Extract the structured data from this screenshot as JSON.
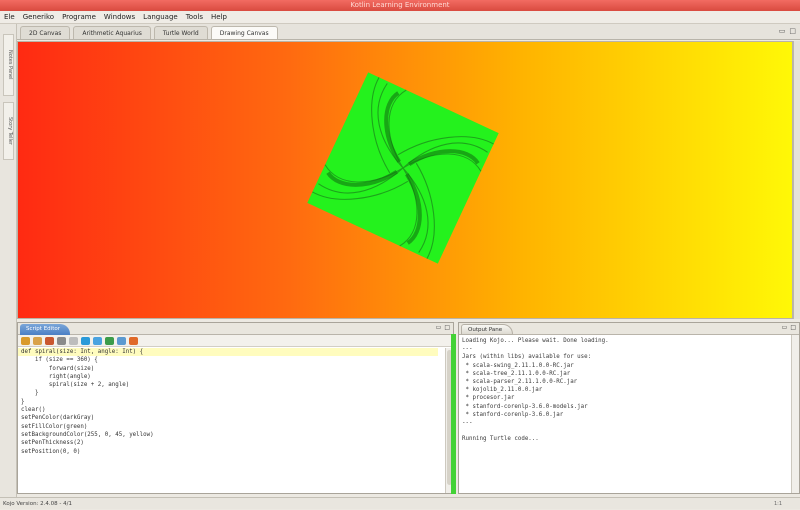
{
  "window": {
    "title": "Kotlin Learning Environment"
  },
  "menu": [
    "Ele",
    "Generiko",
    "Programe",
    "Windows",
    "Language",
    "Tools",
    "Help"
  ],
  "tabs": [
    {
      "label": "2D Canvas",
      "active": false
    },
    {
      "label": "Arithmetic Aquarius",
      "active": false
    },
    {
      "label": "Turtle World",
      "active": false
    },
    {
      "label": "Drawing Canvas",
      "active": true
    }
  ],
  "left_panels": [
    "Notes Panel",
    "Story Teller"
  ],
  "canvas": {
    "gradient": [
      "#ff2a12",
      "#ffb300",
      "#fff806"
    ],
    "shape_fill": "#24f21d",
    "shape_stroke": "#1a8a1a"
  },
  "script_editor": {
    "title": "Script Editor",
    "lines": [
      {
        "text": "def spiral(size: Int, angle: Int) {",
        "highlight": true
      },
      {
        "text": "    if (size == 360) {",
        "highlight": false
      },
      {
        "text": "        forward(size)",
        "highlight": false
      },
      {
        "text": "        right(angle)",
        "highlight": false
      },
      {
        "text": "        spiral(size + 2, angle)",
        "highlight": false
      },
      {
        "text": "    }",
        "highlight": false
      },
      {
        "text": "}",
        "highlight": false
      },
      {
        "text": "clear()",
        "highlight": false
      },
      {
        "text": "setPenColor(darkGray)",
        "highlight": false
      },
      {
        "text": "setFillColor(green)",
        "highlight": false
      },
      {
        "text": "setBackgroundColor(255, 0, 45, yellow)",
        "highlight": false
      },
      {
        "text": "setPenThickness(2)",
        "highlight": false
      },
      {
        "text": "setPosition(0, 0)",
        "highlight": false
      }
    ]
  },
  "output_pane": {
    "title": "Output Pane",
    "lines": [
      "Loading Kojo... Please wait. Done loading.",
      "---",
      "Jars (within libs) available for use:",
      " * scala-swing_2.11.1.0.0-RC.jar",
      " * scala-tree_2.11.1.0.0-RC.jar",
      " * scala-parser_2.11.1.0.0-RC.jar",
      " * kojolib_2.11.0.0.jar",
      " * procesor.jar",
      " * stanford-corenlp-3.6.0-models.jar",
      " * stanford-corenlp-3.6.0.jar",
      "---",
      "",
      "Running Turtle code..."
    ]
  },
  "status": {
    "text": "Kojo Version: 2.4.08 - 4/1",
    "right": "1:1"
  }
}
